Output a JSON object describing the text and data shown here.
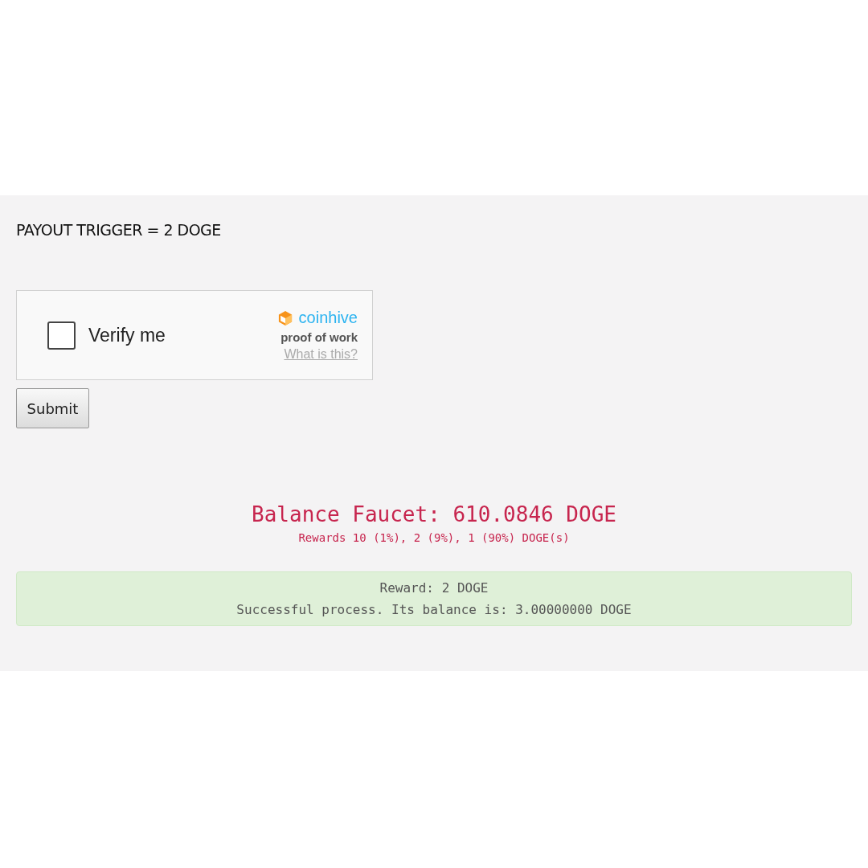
{
  "payout_trigger": "PAYOUT TRIGGER = 2 DOGE",
  "captcha": {
    "label": "Verify me",
    "checked": false,
    "brand": "coinhive",
    "tagline": "proof of work",
    "link": "What is this?"
  },
  "submit_button": "Submit",
  "balance": {
    "title": "Balance Faucet: 610.0846 DOGE",
    "rewards": "Rewards 10 (1%), 2 (9%), 1 (90%) DOGE(s)"
  },
  "alert": {
    "lines": [
      "Reward: 2 DOGE",
      "Successful process. Its balance is: 3.00000000 DOGE"
    ]
  }
}
